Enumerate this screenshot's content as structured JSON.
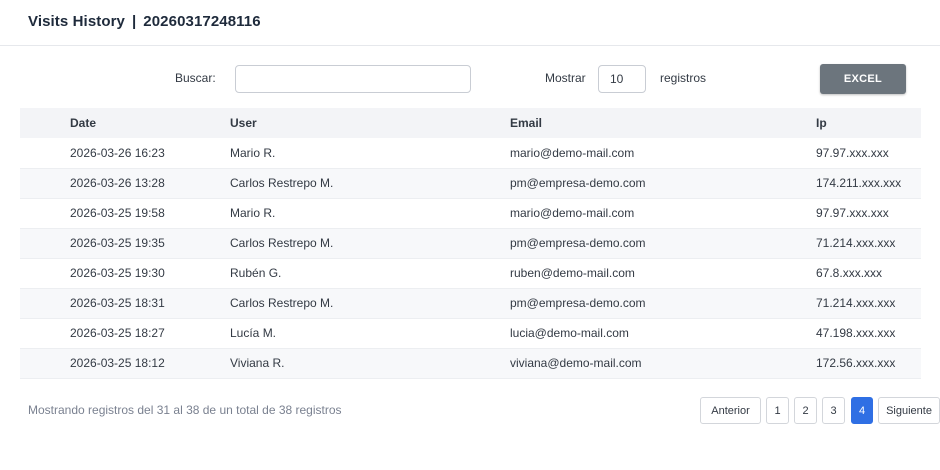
{
  "header": {
    "title": "Visits History",
    "separator": "|",
    "record_id": "20260317248116"
  },
  "controls": {
    "search_label": "Buscar:",
    "search_value": "",
    "show_label": "Mostrar",
    "page_length": "10",
    "records_label": "registros",
    "excel_label": "EXCEL"
  },
  "table": {
    "columns": [
      "Date",
      "User",
      "Email",
      "Ip"
    ],
    "rows": [
      [
        "2026-03-26 16:23",
        "Mario R.",
        "mario@demo-mail.com",
        "97.97.xxx.xxx"
      ],
      [
        "2026-03-26 13:28",
        "Carlos Restrepo M.",
        "pm@empresa-demo.com",
        "174.211.xxx.xxx"
      ],
      [
        "2026-03-25 19:58",
        "Mario R.",
        "mario@demo-mail.com",
        "97.97.xxx.xxx"
      ],
      [
        "2026-03-25 19:35",
        "Carlos Restrepo M.",
        "pm@empresa-demo.com",
        "71.214.xxx.xxx"
      ],
      [
        "2026-03-25 19:30",
        "Rubén G.",
        "ruben@demo-mail.com",
        "67.8.xxx.xxx"
      ],
      [
        "2026-03-25 18:31",
        "Carlos Restrepo M.",
        "pm@empresa-demo.com",
        "71.214.xxx.xxx"
      ],
      [
        "2026-03-25 18:27",
        "Lucía M.",
        "lucia@demo-mail.com",
        "47.198.xxx.xxx"
      ],
      [
        "2026-03-25 18:12",
        "Viviana R.",
        "viviana@demo-mail.com",
        "172.56.xxx.xxx"
      ]
    ]
  },
  "footer": {
    "info": "Mostrando registros del 31 al 38 de un total de 38 registros",
    "prev_label": "Anterior",
    "pages": [
      "1",
      "2",
      "3",
      "4"
    ],
    "current_page": "4",
    "next_label": "Siguiente"
  },
  "colors": {
    "accent": "#2f6fe4",
    "excel_button": "#6c757d",
    "header_row": "#f3f4f7",
    "stripe": "#f7f8fa"
  }
}
